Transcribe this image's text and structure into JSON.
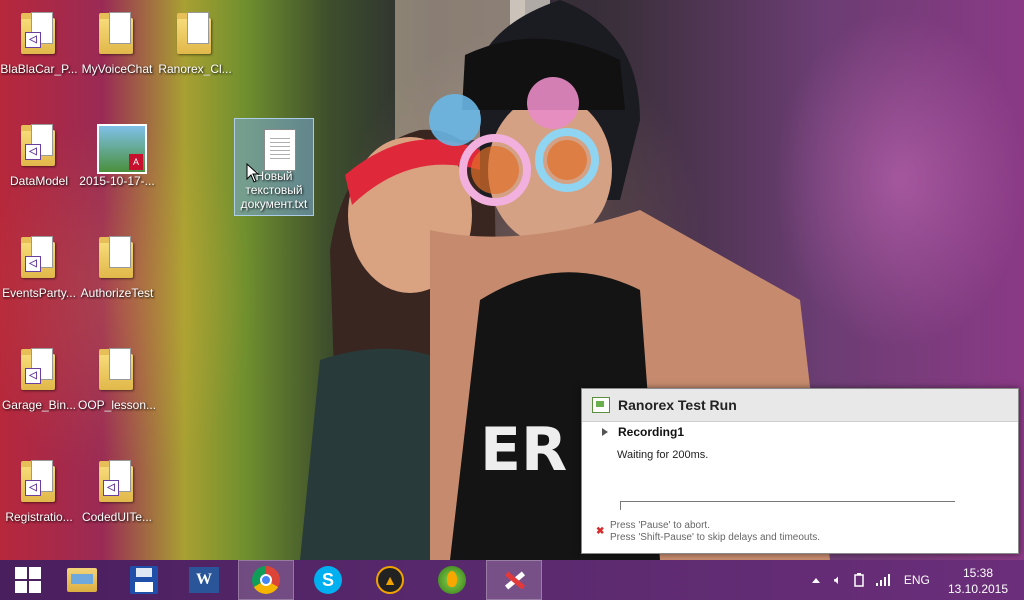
{
  "desktop": {
    "icons": [
      {
        "label": "BlaBlaCar_P..."
      },
      {
        "label": "MyVoiceChat"
      },
      {
        "label": "Ranorex_Cl..."
      },
      {
        "label": "DataModel"
      },
      {
        "label": "2015-10-17-..."
      },
      {
        "label": "Новый текстовый документ.txt"
      },
      {
        "label": "EventsParty..."
      },
      {
        "label": "AuthorizeTest"
      },
      {
        "label": "Garage_Bin..."
      },
      {
        "label": "OOP_lesson..."
      },
      {
        "label": "Registratio..."
      },
      {
        "label": "CodedUITe..."
      }
    ]
  },
  "dialog": {
    "title": "Ranorex Test Run",
    "recording": "Recording1",
    "status": "Waiting for 200ms.",
    "hint_line1": "Press 'Pause' to abort.",
    "hint_line2": "Press 'Shift-Pause' to skip delays and timeouts.",
    "progress": 0
  },
  "taskbar": {
    "apps": [
      "start-icon",
      "file-explorer-icon",
      "save-floppy-icon",
      "word-icon",
      "chrome-icon",
      "skype-icon",
      "aimp-icon",
      "fl-studio-icon",
      "ranorex-icon"
    ],
    "active": "chrome-icon",
    "language": "ENG",
    "time": "15:38",
    "date": "13.10.2015"
  }
}
